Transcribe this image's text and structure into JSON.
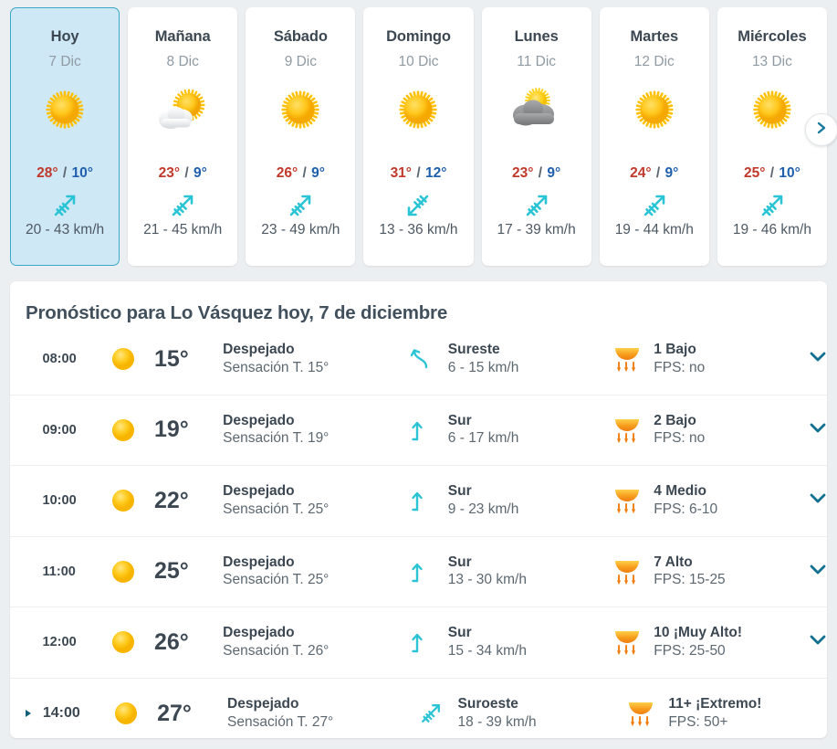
{
  "colors": {
    "accent_teal": "#3aa8c6",
    "today_bg": "#cfe8f6",
    "temp_max": "#c0392b",
    "temp_min": "#1f5fad",
    "text_dark": "#3c4752",
    "text_muted": "#8f9aa3",
    "wind_cyan": "#2bc4d4",
    "uv_orange": "#f09a1e",
    "chevron_blue": "#11708f",
    "page_bg": "#eceff1"
  },
  "days_strip": {
    "next_button_icon": "chevron-right-icon",
    "days": [
      {
        "name": "Hoy",
        "date": "7 Dic",
        "sky_icon": "sun-icon",
        "temp_max": "28°",
        "separator": "/",
        "temp_min": "10°",
        "wind_icon": "wind-arrow-ne-icon",
        "wind": "20 - 43 km/h",
        "selected": true
      },
      {
        "name": "Mañana",
        "date": "8 Dic",
        "sky_icon": "sun-behind-cloud-icon",
        "temp_max": "23°",
        "separator": "/",
        "temp_min": "9°",
        "wind_icon": "wind-arrow-ne-icon",
        "wind": "21 - 45 km/h",
        "selected": false
      },
      {
        "name": "Sábado",
        "date": "9 Dic",
        "sky_icon": "sun-icon",
        "temp_max": "26°",
        "separator": "/",
        "temp_min": "9°",
        "wind_icon": "wind-arrow-ne-icon",
        "wind": "23 - 49 km/h",
        "selected": false
      },
      {
        "name": "Domingo",
        "date": "10 Dic",
        "sky_icon": "sun-icon",
        "temp_max": "31°",
        "separator": "/",
        "temp_min": "12°",
        "wind_icon": "wind-arrow-sw-icon",
        "wind": "13 - 36 km/h",
        "selected": false
      },
      {
        "name": "Lunes",
        "date": "11 Dic",
        "sky_icon": "cloud-with-sun-icon",
        "temp_max": "23°",
        "separator": "/",
        "temp_min": "9°",
        "wind_icon": "wind-arrow-ne-icon",
        "wind": "17 - 39 km/h",
        "selected": false
      },
      {
        "name": "Martes",
        "date": "12 Dic",
        "sky_icon": "sun-icon",
        "temp_max": "24°",
        "separator": "/",
        "temp_min": "9°",
        "wind_icon": "wind-arrow-ne-icon",
        "wind": "19 - 44 km/h",
        "selected": false
      },
      {
        "name": "Miércoles",
        "date": "13 Dic",
        "sky_icon": "sun-icon",
        "temp_max": "25°",
        "separator": "/",
        "temp_min": "10°",
        "wind_icon": "wind-arrow-ne-icon",
        "wind": "19 - 46 km/h",
        "selected": false
      }
    ]
  },
  "hourly": {
    "title": "Pronóstico para Lo Vásquez hoy, 7 de diciembre",
    "rows": [
      {
        "time": "08:00",
        "sky_icon": "sun-icon",
        "temp": "15°",
        "sky": "Despejado",
        "feels": "Sensación T. 15°",
        "wind_icon": "wind-arrow-se-icon",
        "wind_dir": "Sureste",
        "wind_speed": "6 - 15 km/h",
        "uv_icon": "uv-index-icon",
        "uv": "1 Bajo",
        "fps": "FPS: no",
        "expander_icon": null,
        "chevron_icon": "chevron-down-icon",
        "active": false
      },
      {
        "time": "09:00",
        "sky_icon": "sun-icon",
        "temp": "19°",
        "sky": "Despejado",
        "feels": "Sensación T. 19°",
        "wind_icon": "wind-arrow-n-icon",
        "wind_dir": "Sur",
        "wind_speed": "6 - 17 km/h",
        "uv_icon": "uv-index-icon",
        "uv": "2 Bajo",
        "fps": "FPS: no",
        "expander_icon": null,
        "chevron_icon": "chevron-down-icon",
        "active": false
      },
      {
        "time": "10:00",
        "sky_icon": "sun-icon",
        "temp": "22°",
        "sky": "Despejado",
        "feels": "Sensación T. 25°",
        "wind_icon": "wind-arrow-n-icon",
        "wind_dir": "Sur",
        "wind_speed": "9 - 23 km/h",
        "uv_icon": "uv-index-icon",
        "uv": "4 Medio",
        "fps": "FPS: 6-10",
        "expander_icon": null,
        "chevron_icon": "chevron-down-icon",
        "active": false
      },
      {
        "time": "11:00",
        "sky_icon": "sun-icon",
        "temp": "25°",
        "sky": "Despejado",
        "feels": "Sensación T. 25°",
        "wind_icon": "wind-arrow-n-icon",
        "wind_dir": "Sur",
        "wind_speed": "13 - 30 km/h",
        "uv_icon": "uv-index-icon",
        "uv": "7 Alto",
        "fps": "FPS: 15-25",
        "expander_icon": null,
        "chevron_icon": "chevron-down-icon",
        "active": false
      },
      {
        "time": "12:00",
        "sky_icon": "sun-icon",
        "temp": "26°",
        "sky": "Despejado",
        "feels": "Sensación T. 26°",
        "wind_icon": "wind-arrow-n-icon",
        "wind_dir": "Sur",
        "wind_speed": "15 - 34 km/h",
        "uv_icon": "uv-index-icon",
        "uv": "10 ¡Muy Alto!",
        "fps": "FPS: 25-50",
        "expander_icon": null,
        "chevron_icon": "chevron-down-icon",
        "active": false
      },
      {
        "time": "14:00",
        "sky_icon": "sun-icon",
        "temp": "27°",
        "sky": "Despejado",
        "feels": "Sensación T. 27°",
        "wind_icon": "wind-arrow-ne-icon",
        "wind_dir": "Suroeste",
        "wind_speed": "18 - 39 km/h",
        "uv_icon": "uv-index-icon",
        "uv": "11+ ¡Extremo!",
        "fps": "FPS: 50+",
        "expander_icon": "triangle-right-icon",
        "chevron_icon": null,
        "active": true
      }
    ]
  }
}
